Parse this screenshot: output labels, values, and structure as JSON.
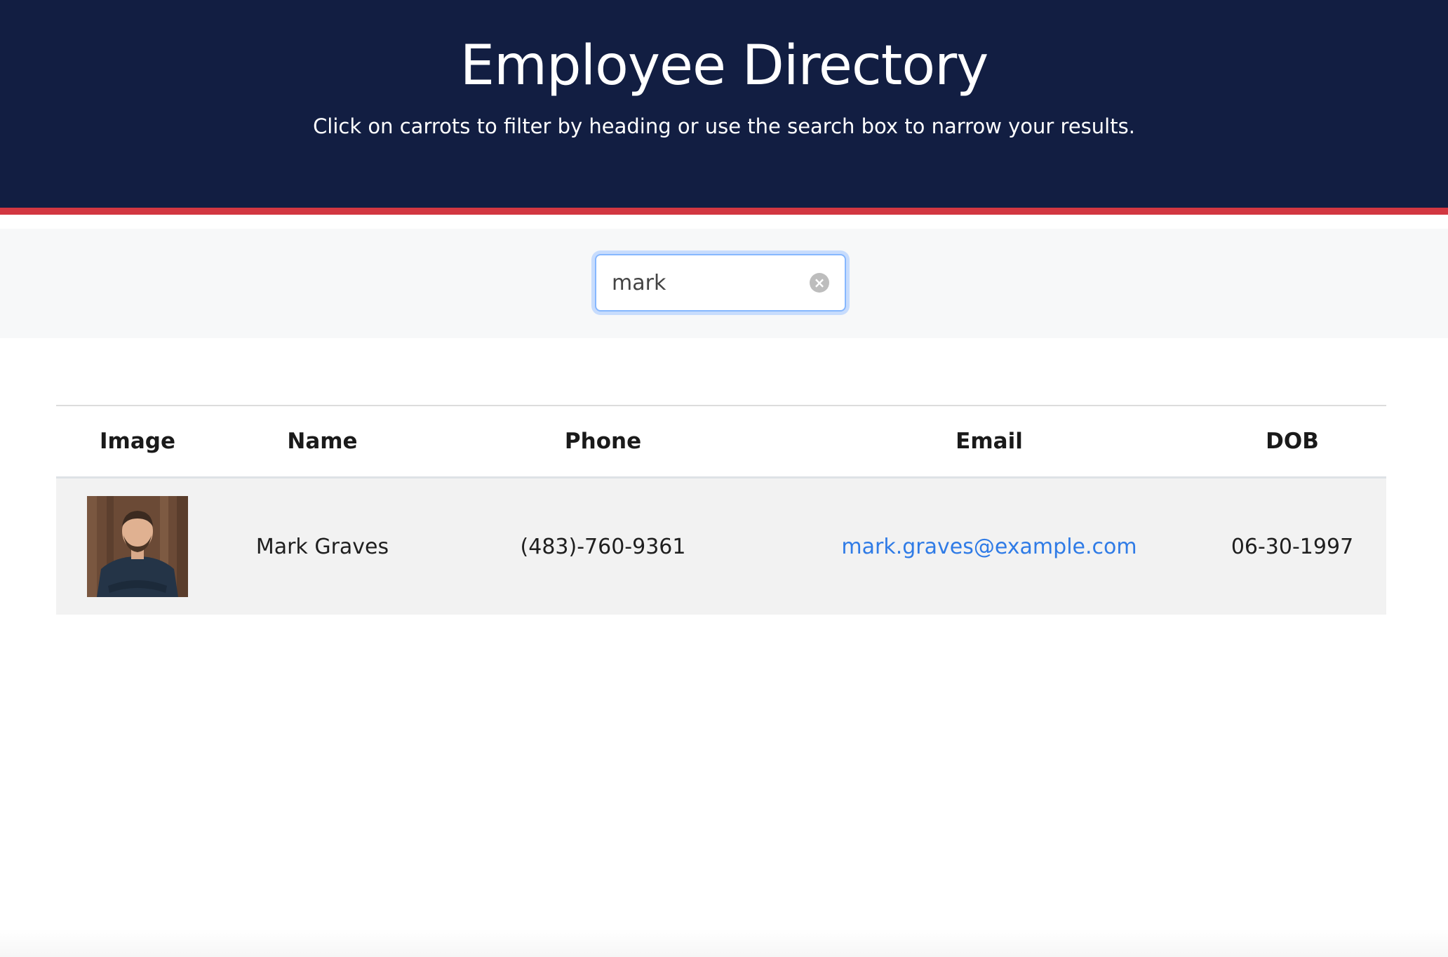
{
  "header": {
    "title": "Employee Directory",
    "subtitle": "Click on carrots to filter by heading or use the search box to narrow your results."
  },
  "search": {
    "value": "mark",
    "clear_icon": "clear-circle-icon"
  },
  "table": {
    "columns": [
      "Image",
      "Name",
      "Phone",
      "Email",
      "DOB"
    ],
    "rows": [
      {
        "image": "employee-photo",
        "name": "Mark Graves",
        "phone": "(483)-760-9361",
        "email": "mark.graves@example.com",
        "dob": "06-30-1997"
      }
    ]
  },
  "colors": {
    "header_bg": "#121e42",
    "accent_red": "#d23741",
    "link": "#2f7be6",
    "row_bg": "#f2f2f2"
  }
}
